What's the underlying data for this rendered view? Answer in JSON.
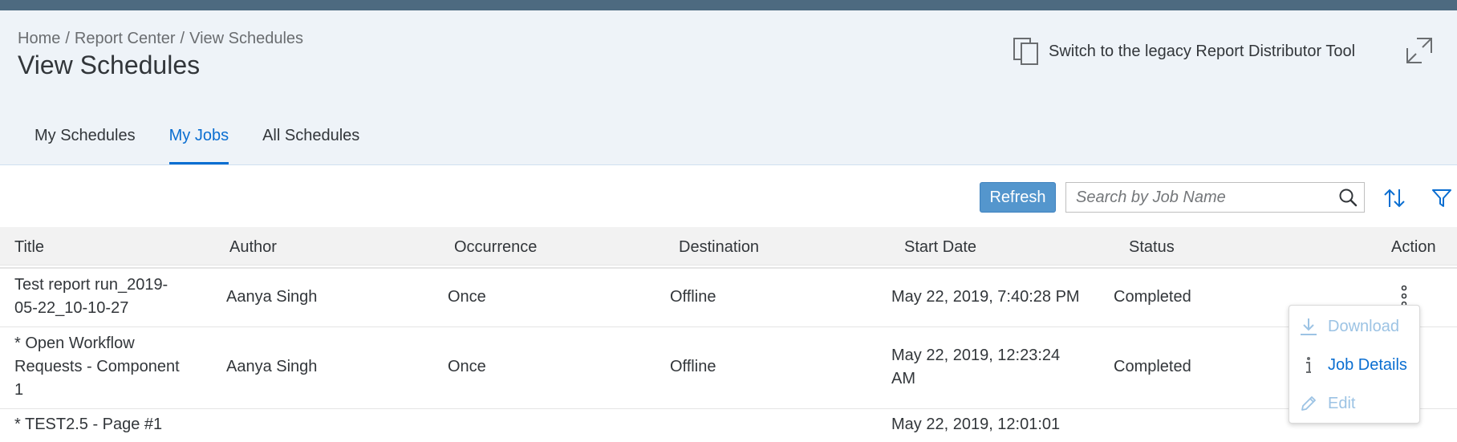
{
  "breadcrumb": {
    "home": "Home",
    "report_center": "Report Center",
    "current": "View Schedules",
    "separator": "/"
  },
  "page_title": "View Schedules",
  "legacy_link": "Switch to the legacy Report Distributor Tool",
  "tabs": [
    {
      "label": "My Schedules",
      "active": false
    },
    {
      "label": "My Jobs",
      "active": true
    },
    {
      "label": "All Schedules",
      "active": false
    }
  ],
  "toolbar": {
    "refresh_label": "Refresh",
    "search_placeholder": "Search by Job Name",
    "search_value": ""
  },
  "table": {
    "columns": [
      "Title",
      "Author",
      "Occurrence",
      "Destination",
      "Start Date",
      "Status",
      "Action"
    ],
    "rows": [
      {
        "title_lines": [
          "Test report run_2019-",
          "05-22_10-10-27"
        ],
        "author": "Aanya Singh",
        "occurrence": "Once",
        "destination": "Offline",
        "start_date_lines": [
          "May 22, 2019, 7:40:28 PM"
        ],
        "status": "Completed"
      },
      {
        "title_lines": [
          "* Open Workflow",
          "Requests - Component",
          "1"
        ],
        "author": "Aanya Singh",
        "occurrence": "Once",
        "destination": "Offline",
        "start_date_lines": [
          "May 22, 2019, 12:23:24",
          "AM"
        ],
        "status": "Completed"
      },
      {
        "title_lines": [
          "* TEST2.5 - Page #1"
        ],
        "author": "",
        "occurrence": "",
        "destination": "",
        "start_date_lines": [
          "May 22, 2019, 12:01:01"
        ],
        "status": ""
      }
    ]
  },
  "action_menu": {
    "items": [
      {
        "label": "Download",
        "icon": "download-icon",
        "enabled": false
      },
      {
        "label": "Job Details",
        "icon": "info-icon",
        "enabled": true
      },
      {
        "label": "Edit",
        "icon": "pencil-icon",
        "enabled": false
      }
    ]
  },
  "colors": {
    "accent": "#0a6ed1",
    "header_bg": "#eef3f8",
    "topbar": "#4d6a80",
    "refresh_bg": "#5496cd"
  }
}
